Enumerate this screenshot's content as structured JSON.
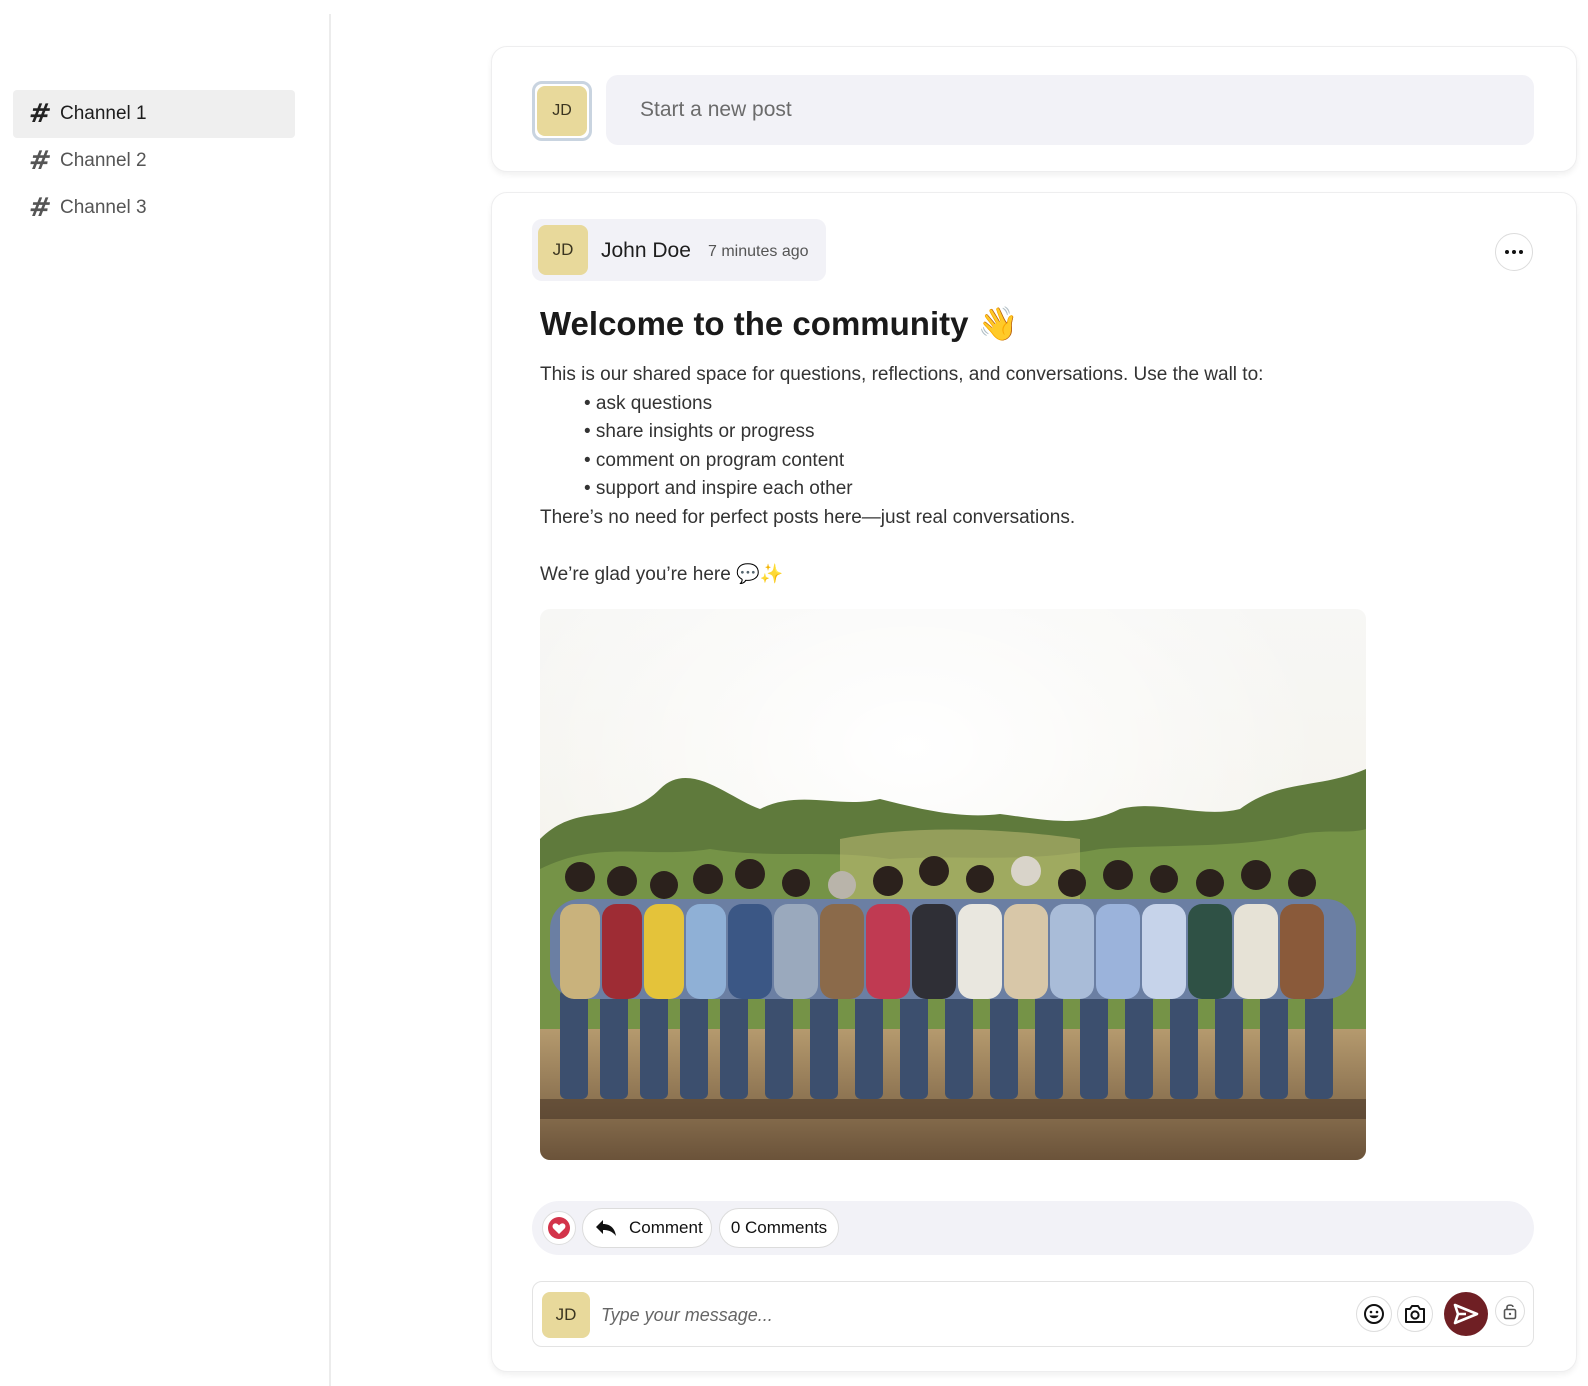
{
  "sidebar": {
    "channels": [
      {
        "label": "Channel 1",
        "active": true
      },
      {
        "label": "Channel 2",
        "active": false
      },
      {
        "label": "Channel 3",
        "active": false
      }
    ]
  },
  "composer": {
    "avatar_initials": "JD",
    "placeholder": "Start a new post"
  },
  "post": {
    "author": {
      "initials": "JD",
      "name": "John Doe"
    },
    "timestamp": "7 minutes ago",
    "title": "Welcome to the community 👋",
    "intro": "This is our shared space for questions, reflections, and conversations. Use the wall to:",
    "bullets": [
      "• ask questions",
      "• share insights or progress",
      "• comment on program content",
      "• support and inspire each other"
    ],
    "outro": "There’s no need for perfect posts here—just real conversations.",
    "closing": "We’re glad you’re here 💬✨",
    "image_icon": "group-photo",
    "actions": {
      "comment_label": "Comment",
      "comment_count_label": "0 Comments"
    },
    "reply": {
      "avatar_initials": "JD",
      "placeholder": "Type your message..."
    }
  },
  "colors": {
    "accent": "#6f1f24",
    "avatar_bg": "#e8d99b",
    "pill_bg": "#f2f2f7",
    "like": "#d3334a"
  },
  "icons": [
    "hash-icon",
    "more-icon",
    "heart-icon",
    "reply-icon",
    "emoji-icon",
    "camera-icon",
    "send-icon",
    "lock-icon"
  ]
}
